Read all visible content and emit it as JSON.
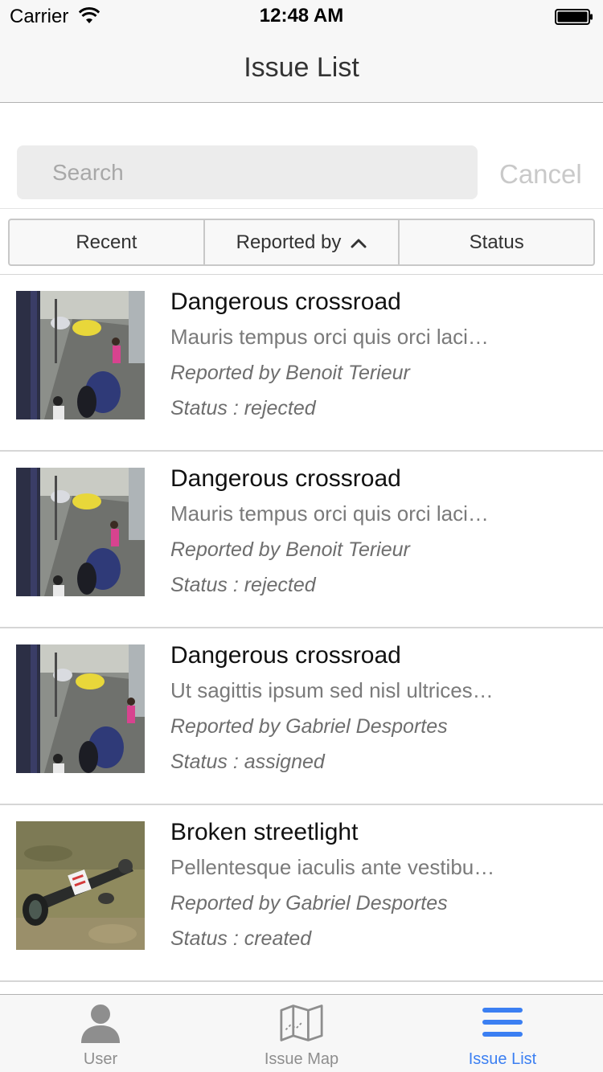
{
  "status_bar": {
    "carrier": "Carrier",
    "time": "12:48 AM"
  },
  "nav": {
    "title": "Issue List"
  },
  "search": {
    "placeholder": "Search",
    "value": "",
    "cancel_label": "Cancel"
  },
  "sort_tabs": [
    {
      "label": "Recent"
    },
    {
      "label": "Reported by"
    },
    {
      "label": "Status"
    }
  ],
  "issues": [
    {
      "title": "Dangerous crossroad",
      "description": "Mauris tempus orci quis orci laci…",
      "reporter": "Reported by Benoit Terieur",
      "status": "Status : rejected",
      "image": "street-crossroad-photo"
    },
    {
      "title": "Dangerous crossroad",
      "description": "Mauris tempus orci quis orci laci…",
      "reporter": "Reported by Benoit Terieur",
      "status": "Status : rejected",
      "image": "street-crossroad-photo"
    },
    {
      "title": "Dangerous crossroad",
      "description": "Ut sagittis ipsum sed nisl ultrices…",
      "reporter": "Reported by Gabriel Desportes",
      "status": "Status : assigned",
      "image": "street-crossroad-photo"
    },
    {
      "title": "Broken streetlight",
      "description": "Pellentesque iaculis ante vestibu…",
      "reporter": "Reported by Gabriel Desportes",
      "status": "Status : created",
      "image": "broken-streetlight-photo"
    }
  ],
  "tab_bar": {
    "tabs": [
      {
        "label": "User",
        "icon": "user-icon",
        "active": false
      },
      {
        "label": "Issue Map",
        "icon": "map-icon",
        "active": false
      },
      {
        "label": "Issue List",
        "icon": "list-icon",
        "active": true
      }
    ]
  },
  "colors": {
    "accent": "#3b7ff2",
    "inactive_tab": "#8e8e8e",
    "bar_background": "#f7f7f7"
  }
}
